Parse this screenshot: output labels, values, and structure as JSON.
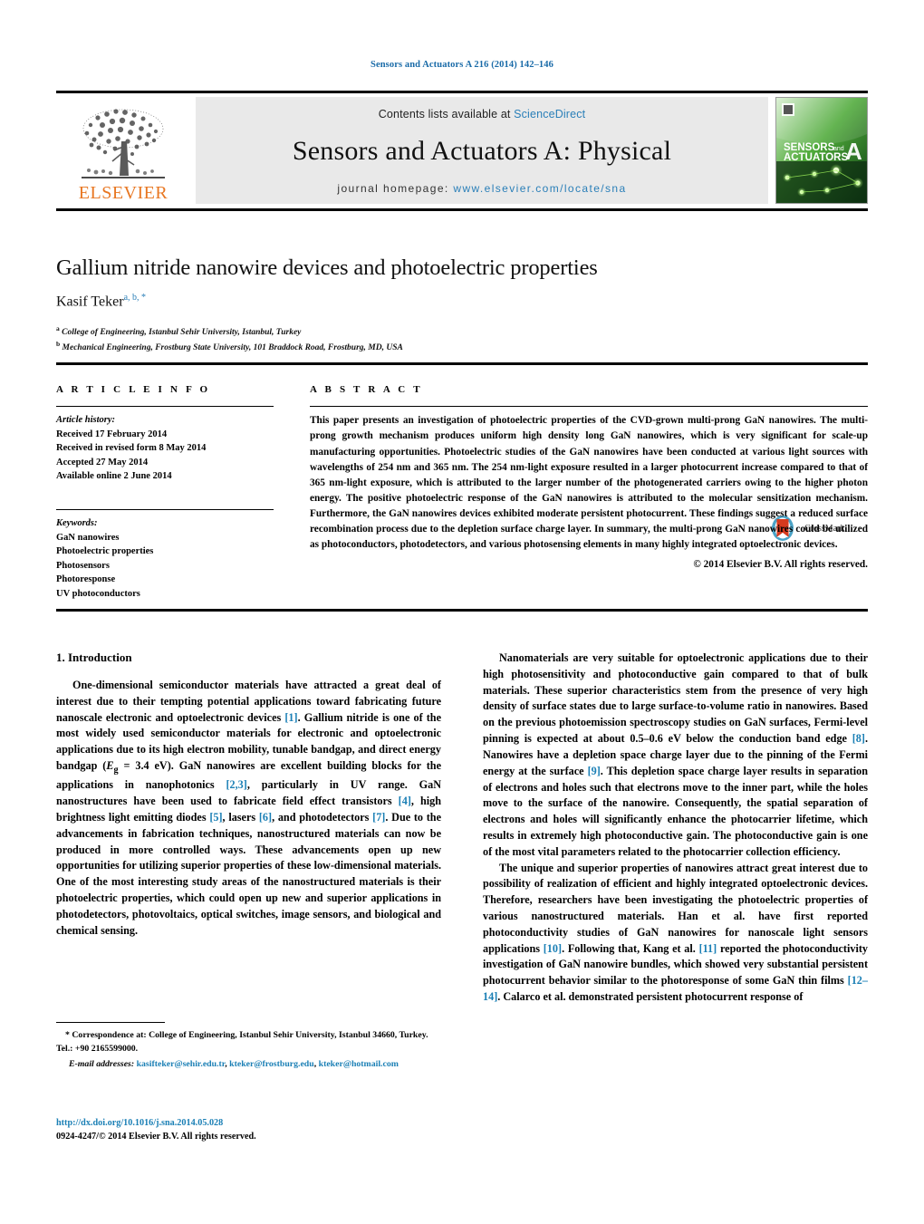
{
  "running_head": "Sensors and Actuators A 216 (2014) 142–146",
  "masthead": {
    "contents_prefix": "Contents lists available at ",
    "contents_link": "ScienceDirect",
    "journal_title": "Sensors and Actuators A: Physical",
    "homepage_prefix": "journal homepage: ",
    "homepage_url": "www.elsevier.com/locate/sna",
    "publisher_logo_text": "ELSEVIER",
    "cover_title_line1": "SENSORS",
    "cover_title_line1_suffix": "and",
    "cover_title_line2": "ACTUATORS",
    "cover_letter": "A"
  },
  "article": {
    "title": "Gallium nitride nanowire devices and photoelectric properties",
    "author": "Kasif Teker",
    "author_sups": "a, b, *",
    "affiliation_a_marker": "a",
    "affiliation_a": "College of Engineering, Istanbul Sehir University, Istanbul, Turkey",
    "affiliation_b_marker": "b",
    "affiliation_b": "Mechanical Engineering, Frostburg State University, 101 Braddock Road, Frostburg, MD, USA",
    "crossmark_label": "CrossMark"
  },
  "info": {
    "heading": "A R T I C L E    I N F O",
    "history_label": "Article history:",
    "history": [
      "Received 17 February 2014",
      "Received in revised form 8 May 2014",
      "Accepted 27 May 2014",
      "Available online 2 June 2014"
    ],
    "keywords_label": "Keywords:",
    "keywords": [
      "GaN nanowires",
      "Photoelectric properties",
      "Photosensors",
      "Photoresponse",
      "UV photoconductors"
    ]
  },
  "abstract": {
    "heading": "A B S T R A C T",
    "text": "This paper presents an investigation of photoelectric properties of the CVD-grown multi-prong GaN nanowires. The multi-prong growth mechanism produces uniform high density long GaN nanowires, which is very significant for scale-up manufacturing opportunities. Photoelectric studies of the GaN nanowires have been conducted at various light sources with wavelengths of 254 nm and 365 nm. The 254 nm-light exposure resulted in a larger photocurrent increase compared to that of 365 nm-light exposure, which is attributed to the larger number of the photogenerated carriers owing to the higher photon energy. The positive photoelectric response of the GaN nanowires is attributed to the molecular sensitization mechanism. Furthermore, the GaN nanowires devices exhibited moderate persistent photocurrent. These findings suggest a reduced surface recombination process due to the depletion surface charge layer. In summary, the multi-prong GaN nanowires could be utilized as photoconductors, photodetectors, and various photosensing elements in many highly integrated optoelectronic devices.",
    "copyright": "© 2014 Elsevier B.V. All rights reserved."
  },
  "body": {
    "section_title": "1.  Introduction",
    "left_p1_a": "One-dimensional semiconductor materials have attracted a great deal of interest due to their tempting potential applications toward fabricating future nanoscale electronic and optoelectronic devices ",
    "left_p1_ref1": "[1]",
    "left_p1_b": ". Gallium nitride is one of the most widely used semiconductor materials for electronic and optoelectronic applications due to its high electron mobility, tunable bandgap, and direct energy bandgap (",
    "left_p1_eq_var": "E",
    "left_p1_eq_sub": "g",
    "left_p1_eq_rest": " = 3.4 eV). GaN nanowires are excellent building blocks for the applications in nanophotonics ",
    "left_p1_ref2": "[2,3]",
    "left_p1_c": ", particularly in UV range. GaN nanostructures have been used to fabricate field effect transistors ",
    "left_p1_ref3": "[4]",
    "left_p1_d": ", high brightness light emitting diodes ",
    "left_p1_ref4": "[5]",
    "left_p1_e": ", lasers ",
    "left_p1_ref5": "[6]",
    "left_p1_f": ", and photodetectors ",
    "left_p1_ref6": "[7]",
    "left_p1_g": ". Due to the advancements in fabrication techniques, nanostructured materials can now be produced in more controlled ways. These advancements open up new opportunities for utilizing superior properties of these low-dimensional materials. One of the most interesting study areas of the nanostructured materials is their photoelectric properties, which could open up new and superior applications in photodetectors, photovoltaics, optical switches, image sensors, and biological and chemical sensing.",
    "right_p1_a": "Nanomaterials are very suitable for optoelectronic applications due to their high photosensitivity and photoconductive gain compared to that of bulk materials. These superior characteristics stem from the presence of very high density of surface states due to large surface-to-volume ratio in nanowires. Based on the previous photoemission spectroscopy studies on GaN surfaces, Fermi-level pinning is expected at about 0.5–0.6 eV below the conduction band edge ",
    "right_p1_ref1": "[8]",
    "right_p1_b": ". Nanowires have a depletion space charge layer due to the pinning of the Fermi energy at the surface ",
    "right_p1_ref2": "[9]",
    "right_p1_c": ". This depletion space charge layer results in separation of electrons and holes such that electrons move to the inner part, while the holes move to the surface of the nanowire. Consequently, the spatial separation of electrons and holes will significantly enhance the photocarrier lifetime, which results in extremely high photoconductive gain. The photoconductive gain is one of the most vital parameters related to the photocarrier collection efficiency.",
    "right_p2_a": "The unique and superior properties of nanowires attract great interest due to possibility of realization of efficient and highly integrated optoelectronic devices. Therefore, researchers have been investigating the photoelectric properties of various nanostructured materials. Han et al. have first reported photoconductivity studies of GaN nanowires for nanoscale light sensors applications ",
    "right_p2_ref1": "[10]",
    "right_p2_b": ". Following that, Kang et al. ",
    "right_p2_ref2": "[11]",
    "right_p2_c": " reported the photoconductivity investigation of GaN nanowire bundles, which showed very substantial persistent photocurrent behavior similar to the photoresponse of some GaN thin films ",
    "right_p2_ref3": "[12–14]",
    "right_p2_d": ". Calarco et al. demonstrated persistent photocurrent response of"
  },
  "footnotes": {
    "star": "*",
    "correspondence": " Correspondence at: College of Engineering, Istanbul Sehir University, Istanbul 34660, Turkey. Tel.: +90 2165599000.",
    "email_label": "E-mail addresses:",
    "email1": "kasifteker@sehir.edu.tr",
    "email2": "kteker@frostburg.edu",
    "email3": "kteker@hotmail.com",
    "doi": "http://dx.doi.org/10.1016/j.sna.2014.05.028",
    "issn_line": "0924-4247/© 2014 Elsevier B.V. All rights reserved."
  },
  "colors": {
    "link_blue": "#1a7fb5",
    "elsevier_orange": "#E87722",
    "running_head_blue": "#1a6ba8",
    "masthead_gray": "#e9e9e9"
  }
}
